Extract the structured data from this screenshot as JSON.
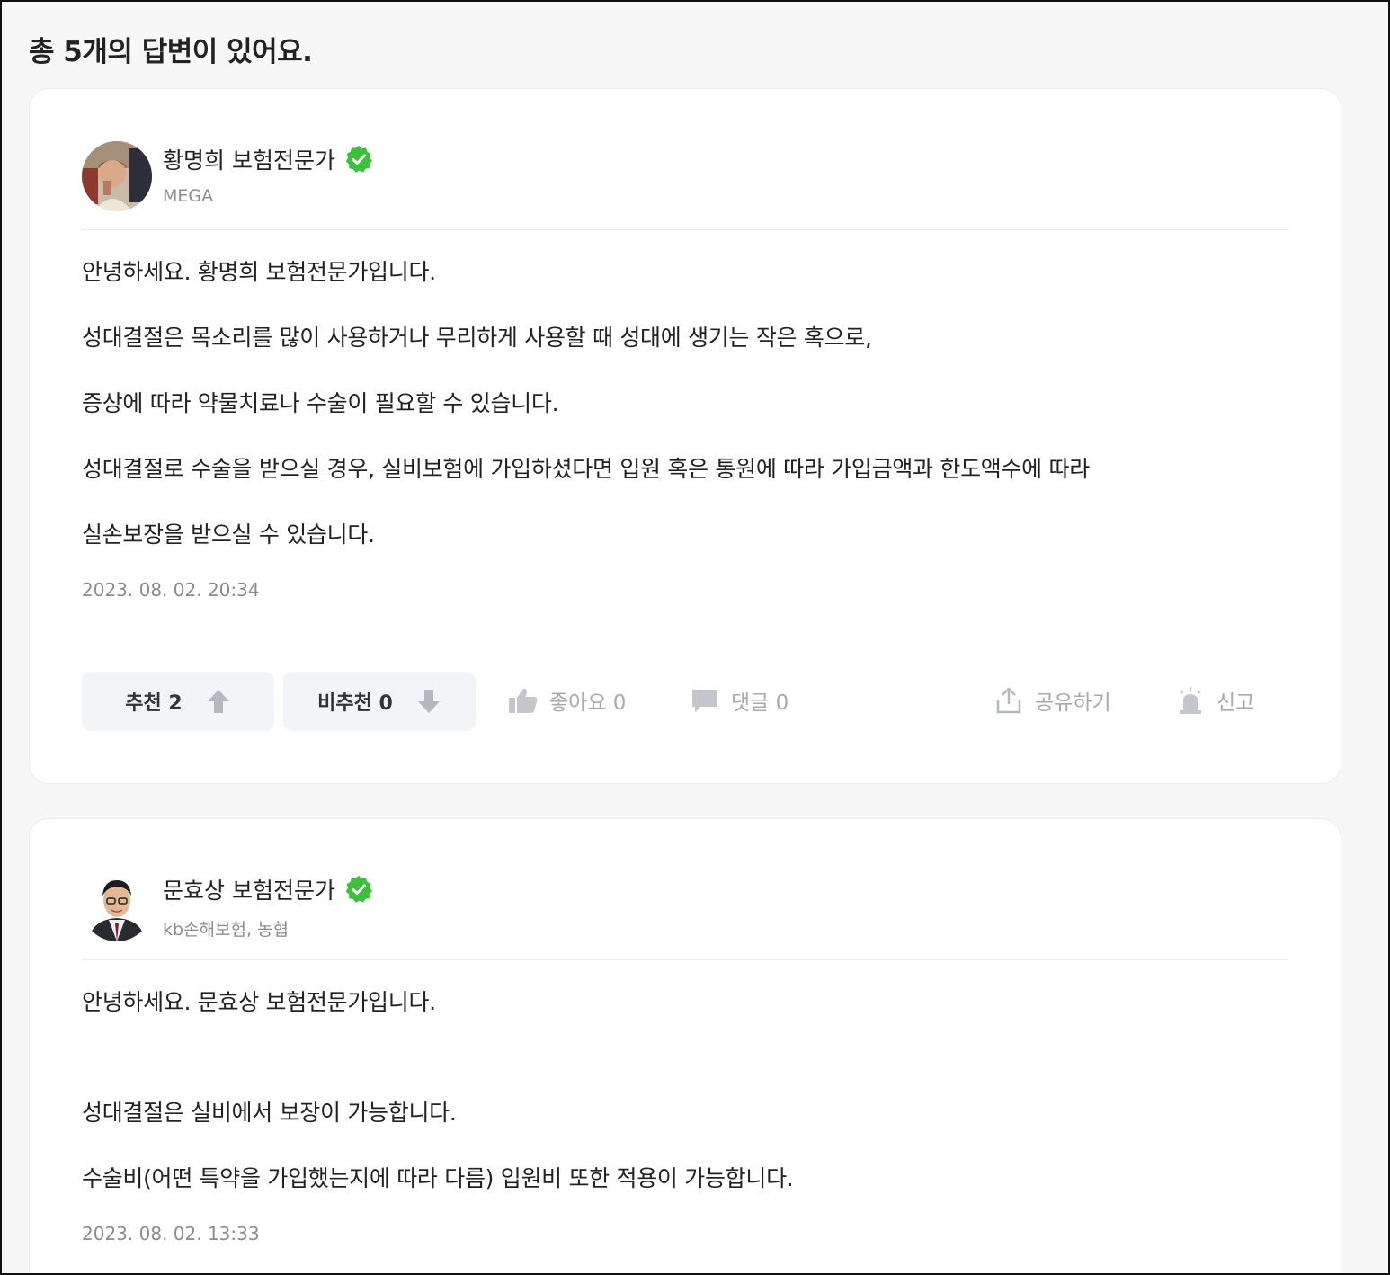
{
  "header": {
    "title": "총 5개의 답변이 있어요."
  },
  "answers": [
    {
      "author_name": "황명희 보험전문가",
      "author_org": "MEGA",
      "verified_icon": "verified-check-icon",
      "lines": [
        "안녕하세요. 황명희 보험전문가입니다.",
        "성대결절은 목소리를 많이 사용하거나 무리하게 사용할 때 성대에 생기는 작은 혹으로,",
        "증상에 따라 약물치료나 수술이 필요할 수 있습니다.",
        "성대결절로 수술을 받으실 경우, 실비보험에 가입하셨다면 입원 혹은 통원에 따라 가입금액과 한도액수에 따라",
        "실손보장을 받으실 수 있습니다."
      ],
      "timestamp": "2023. 08. 02. 20:34",
      "recommend_label": "추천 2",
      "not_recommend_label": "비추천 0",
      "like_label": "좋아요 0",
      "comment_label": "댓글 0",
      "share_label": "공유하기",
      "report_label": "신고"
    },
    {
      "author_name": "문효상 보험전문가",
      "author_org": "kb손해보험, 농협",
      "verified_icon": "verified-check-icon",
      "lines": [
        "안녕하세요. 문효상 보험전문가입니다.",
        "성대결절은 실비에서 보장이 가능합니다.",
        "수술비(어떤 특약을 가입했는지에 따라 다름) 입원비 또한 적용이 가능합니다."
      ],
      "timestamp": "2023. 08. 02. 13:33"
    }
  ],
  "colors": {
    "verified": "#3cc13b",
    "muted_text": "#8b8b92",
    "button_bg": "#f3f4f7",
    "arrow": "#b5b8bf"
  }
}
